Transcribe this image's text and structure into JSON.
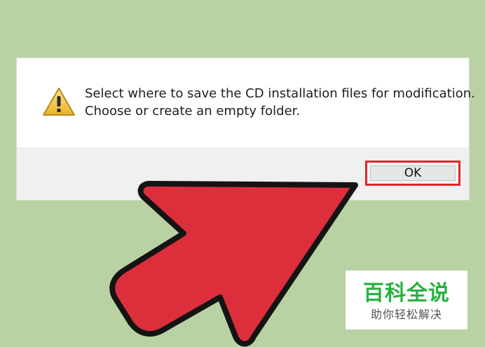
{
  "dialog": {
    "icon": "warning-icon",
    "message_line1": "Select where to save the CD installation files for modification.",
    "message_line2": "Choose or create an empty folder.",
    "ok_label": "OK"
  },
  "overlay": {
    "arrow_icon": "arrow-pointer-icon",
    "arrow_color": "#dd2f3b",
    "highlight_color": "#e0262b"
  },
  "watermark": {
    "title": "百科全说",
    "subtitle": "助你轻松解决",
    "title_color": "#26b23f"
  }
}
